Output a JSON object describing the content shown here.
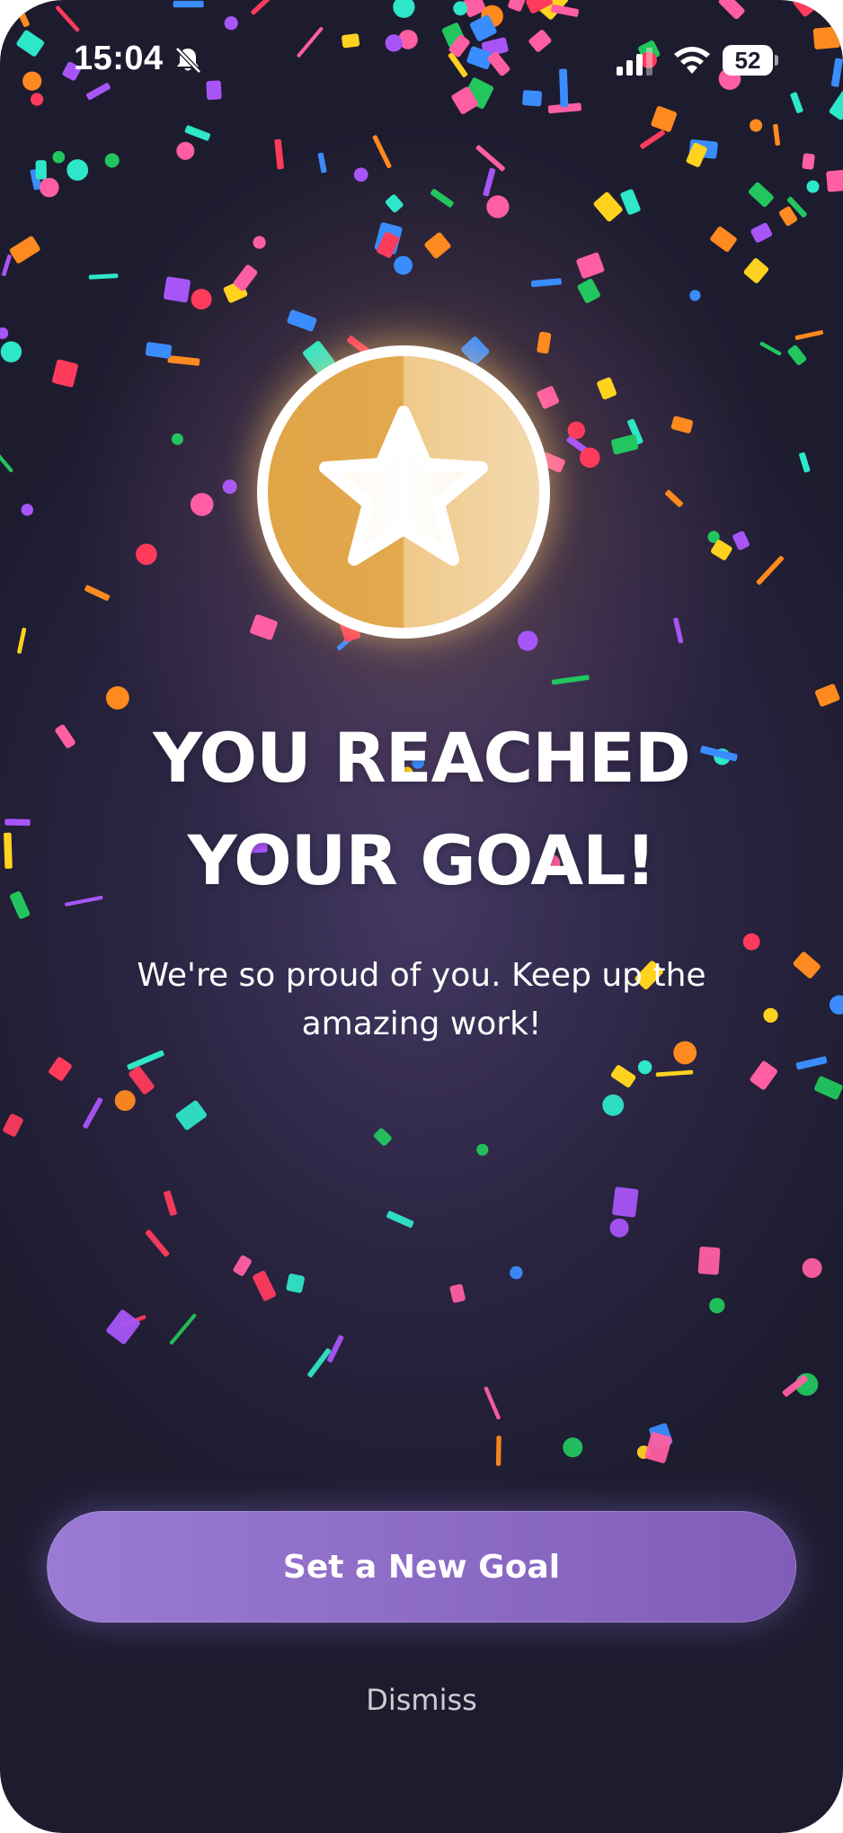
{
  "status_bar": {
    "time": "15:04",
    "battery_level": "52",
    "icons": [
      "bell-slash-icon",
      "cellular-signal-icon",
      "wifi-icon",
      "battery-icon"
    ]
  },
  "celebration": {
    "medal_icon": "star-icon",
    "headline_line1": "YOU REACHED",
    "headline_line2": "YOUR GOAL!",
    "message": "We're so proud of you. Keep up the amazing work!"
  },
  "actions": {
    "primary_label": "Set a New Goal",
    "secondary_label": "Dismiss"
  },
  "colors": {
    "background": "#1d1c2f",
    "accent": "#8d6cc6",
    "medal_gold": "#e2a84d",
    "confetti": [
      "#ff3b5c",
      "#2ee6c8",
      "#ffd21f",
      "#3b8cff",
      "#a855f7",
      "#22c55e",
      "#ff8a1f",
      "#ff5fa2"
    ]
  }
}
